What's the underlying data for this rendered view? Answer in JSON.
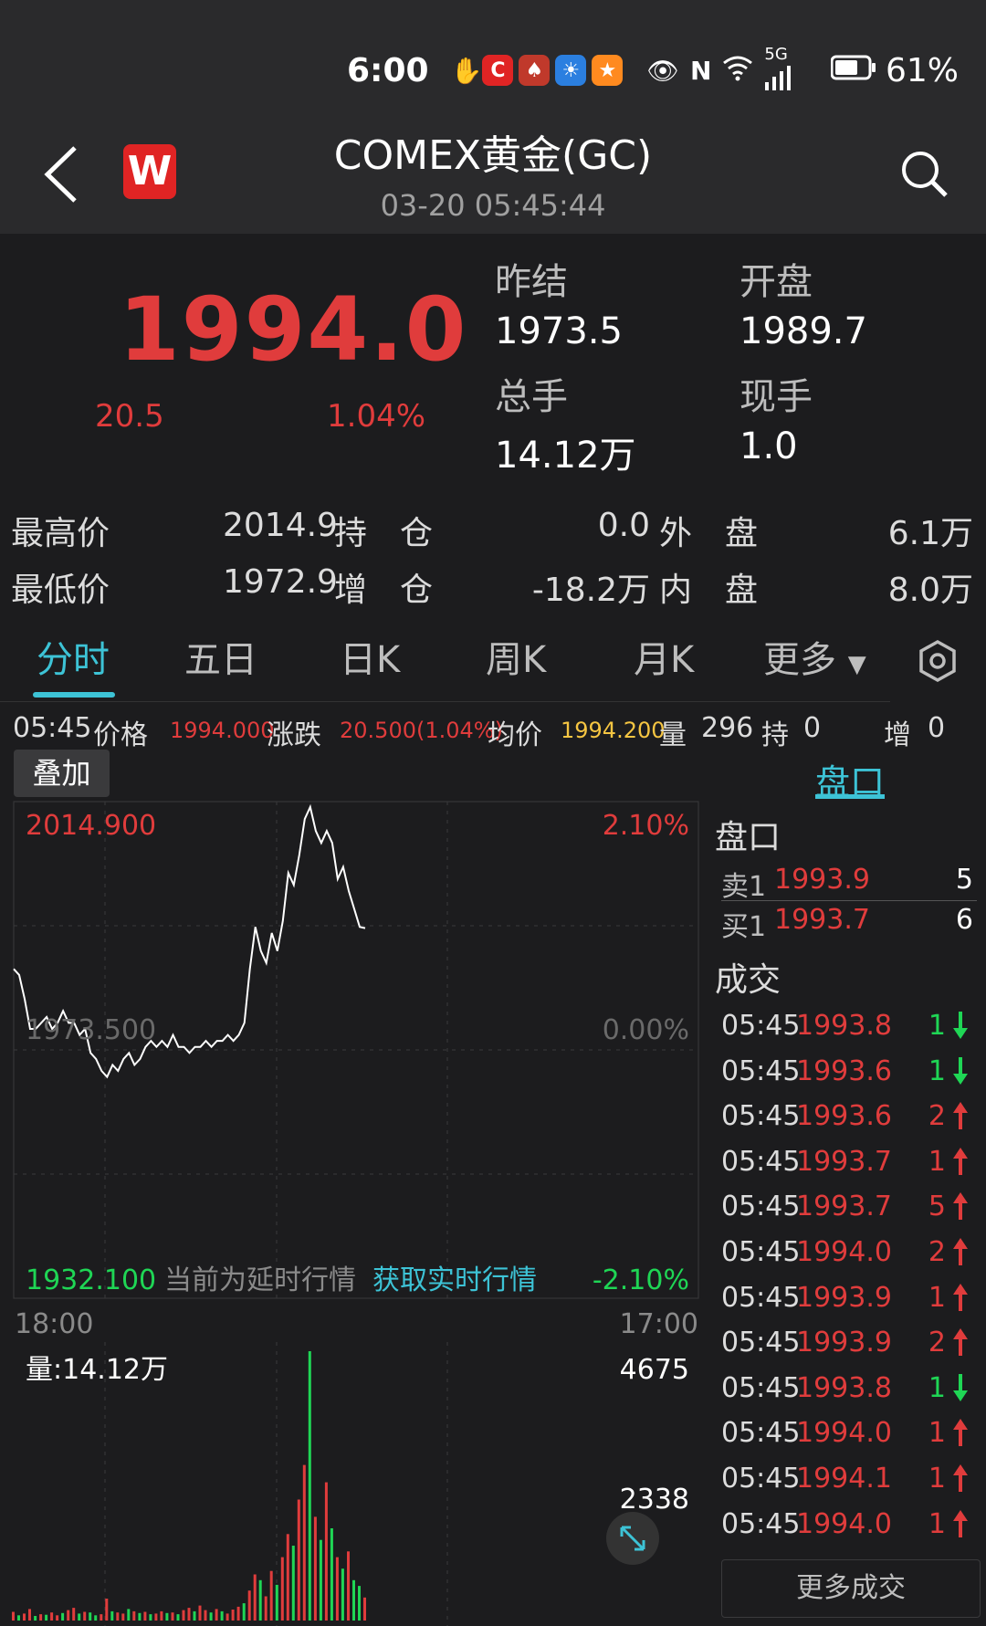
{
  "status_bar": {
    "time": "6:00",
    "battery": "61%",
    "signal": "5G"
  },
  "header": {
    "title": "COMEX黄金(GC)",
    "datetime": "03-20 05:45:44",
    "logo_letter": "W"
  },
  "quote": {
    "price": "1994.0",
    "change": "20.5",
    "change_pct": "1.04%",
    "prev_settle_label": "昨结",
    "prev_settle": "1973.5",
    "open_label": "开盘",
    "open": "1989.7",
    "total_volume_label": "总手",
    "total_volume": "14.12万",
    "current_volume_label": "现手",
    "current_volume": "1.0"
  },
  "stats": {
    "high_label": "最高价",
    "high": "2014.9",
    "oi_label": "持　仓",
    "oi": "0.0",
    "outer_label": "外　盘",
    "outer": "6.1万",
    "low_label": "最低价",
    "low": "1972.9",
    "oi_change_label": "增　仓",
    "oi_change": "-18.2万",
    "inner_label": "内　盘",
    "inner": "8.0万"
  },
  "tabs": [
    "分时",
    "五日",
    "日K",
    "周K",
    "月K",
    "更多"
  ],
  "info_bar": {
    "time": "05:45",
    "price_label": "价格",
    "price": "1994.000",
    "change_label": "涨跌",
    "change": "20.500(1.04%)",
    "avg_label": "均价",
    "avg": "1994.200",
    "vol_label": "量",
    "vol": "296",
    "oi_label": "持",
    "oi": "0",
    "inc_label": "增",
    "inc": "0"
  },
  "overlay_label": "叠加",
  "side_tab": "盘口",
  "order_book": {
    "title": "盘口",
    "rows": [
      {
        "label": "卖1",
        "price": "1993.9",
        "qty": "5"
      },
      {
        "label": "买1",
        "price": "1993.7",
        "qty": "6"
      }
    ]
  },
  "trades_title": "成交",
  "trades": [
    {
      "time": "05:45",
      "price": "1993.8",
      "qty": "1",
      "dir": "down"
    },
    {
      "time": "05:45",
      "price": "1993.6",
      "qty": "1",
      "dir": "down"
    },
    {
      "time": "05:45",
      "price": "1993.6",
      "qty": "2",
      "dir": "up"
    },
    {
      "time": "05:45",
      "price": "1993.7",
      "qty": "1",
      "dir": "up"
    },
    {
      "time": "05:45",
      "price": "1993.7",
      "qty": "5",
      "dir": "up"
    },
    {
      "time": "05:45",
      "price": "1994.0",
      "qty": "2",
      "dir": "up"
    },
    {
      "time": "05:45",
      "price": "1993.9",
      "qty": "1",
      "dir": "up"
    },
    {
      "time": "05:45",
      "price": "1993.9",
      "qty": "2",
      "dir": "up"
    },
    {
      "time": "05:45",
      "price": "1993.8",
      "qty": "1",
      "dir": "down"
    },
    {
      "time": "05:45",
      "price": "1994.0",
      "qty": "1",
      "dir": "up"
    },
    {
      "time": "05:45",
      "price": "1994.1",
      "qty": "1",
      "dir": "up"
    },
    {
      "time": "05:45",
      "price": "1994.0",
      "qty": "1",
      "dir": "up"
    }
  ],
  "more_trades_label": "更多成交",
  "chart": {
    "top_price": "2014.900",
    "top_pct": "2.10%",
    "mid_price": "1973.500",
    "mid_pct": "0.00%",
    "bottom_price": "1932.100",
    "bottom_pct": "-2.10%",
    "delay_notice": "当前为延时行情",
    "realtime_link": "获取实时行情",
    "x_start": "18:00",
    "x_end": "17:00",
    "vol_label": "量:14.12万",
    "vol_max": "4675",
    "vol_mid": "2338",
    "colors": {
      "up": "#e03c3c",
      "down": "#1fd655",
      "line": "#ffffff",
      "link": "#3dc3d6"
    }
  },
  "chart_data": {
    "type": "line",
    "ylim": [
      1932.1,
      2014.9
    ],
    "x_range": [
      "18:00",
      "17:00"
    ],
    "series": [
      {
        "values": [
          1987,
          1986,
          1982,
          1977,
          1977,
          1978,
          1979,
          1977,
          1978,
          1980,
          1978,
          1978,
          1976,
          1977,
          1973,
          1972,
          1970,
          1969,
          1971,
          1970,
          1972,
          1973,
          1971,
          1972,
          1974,
          1975,
          1974,
          1975,
          1974,
          1976,
          1974,
          1974,
          1973,
          1974,
          1974,
          1975,
          1974,
          1975,
          1975,
          1976,
          1975,
          1976,
          1978,
          1987,
          1994,
          1990,
          1988,
          1993,
          1990,
          1995,
          2003,
          2001,
          2006,
          2012,
          2014,
          2010,
          2008,
          2010,
          2008,
          2002,
          2004,
          2000,
          1997,
          1994,
          1993.8
        ]
      }
    ],
    "volume": {
      "ylim": [
        0,
        4675
      ],
      "values": [
        150,
        90,
        120,
        200,
        80,
        110,
        100,
        140,
        90,
        130,
        180,
        220,
        120,
        150,
        140,
        90,
        110,
        380,
        160,
        140,
        120,
        200,
        160,
        130,
        150,
        110,
        120,
        160,
        130,
        140,
        110,
        180,
        220,
        160,
        260,
        180,
        140,
        200,
        160,
        120,
        190,
        240,
        300,
        520,
        800,
        700,
        420,
        860,
        620,
        1100,
        1500,
        1300,
        2100,
        2700,
        4675,
        1800,
        1400,
        2400,
        1600,
        1100,
        900,
        1200,
        700,
        600,
        400
      ],
      "up": [
        1,
        0,
        1,
        1,
        0,
        1,
        0,
        1,
        1,
        0,
        1,
        1,
        0,
        1,
        0,
        0,
        1,
        1,
        0,
        1,
        1,
        0,
        1,
        0,
        1,
        0,
        1,
        1,
        0,
        1,
        0,
        1,
        1,
        0,
        1,
        1,
        0,
        1,
        0,
        1,
        1,
        1,
        0,
        1,
        1,
        0,
        1,
        1,
        0,
        1,
        1,
        0,
        1,
        1,
        0,
        1,
        0,
        1,
        0,
        1,
        0,
        1,
        0,
        0,
        1
      ]
    }
  }
}
